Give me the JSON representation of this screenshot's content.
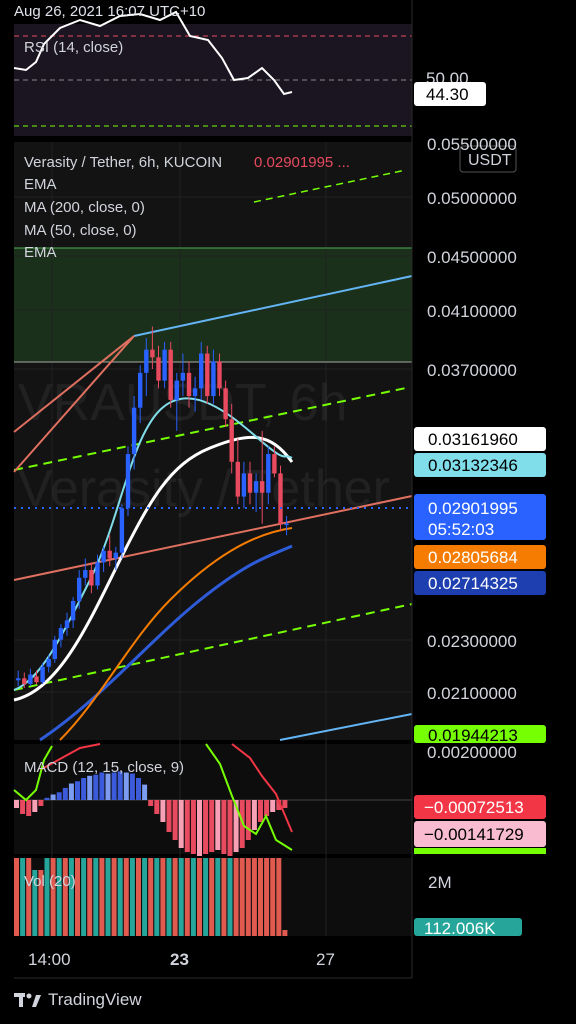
{
  "header": {
    "timestamp": "Aug 26, 2021 16:07 UTC+10"
  },
  "rsi": {
    "label": "RSI (14, close)",
    "value_tag": "44.30",
    "level_tick": "50.00"
  },
  "price_pane": {
    "title_symbol": "Verasity / Tether, 6h, KUCOIN",
    "title_price": "0.02901995 ...",
    "currency": "USDT",
    "watermark_line1": "VRAUSDT, 6h",
    "watermark_line2": "Verasity / Tether",
    "indicators": [
      "EMA",
      "MA (200, close, 0)",
      "MA (50, close, 0)",
      "EMA"
    ],
    "axis_ticks": [
      "0.05500000",
      "0.05000000",
      "0.04500000",
      "0.04100000",
      "0.03700000",
      "0.02300000",
      "0.02100000",
      "0.00200000"
    ],
    "tags": [
      {
        "text": "0.03161960",
        "bg": "#ffffff",
        "fg": "#000000"
      },
      {
        "text": "0.03132346",
        "bg": "#80deea",
        "fg": "#000000"
      },
      {
        "text": "0.02901995",
        "bg": "#2962ff",
        "fg": "#ffffff"
      },
      {
        "text": "05:52:03",
        "bg": "#2962ff",
        "fg": "#ffffff"
      },
      {
        "text": "0.02805684",
        "bg": "#f57c00",
        "fg": "#ffffff"
      },
      {
        "text": "0.02714325",
        "bg": "#1e3fb0",
        "fg": "#ffffff"
      },
      {
        "text": "0.01944213",
        "bg": "#76ff03",
        "fg": "#000000"
      }
    ]
  },
  "macd": {
    "label": "MACD (12, 15, close, 9)",
    "tags": [
      {
        "text": "−0.00072513",
        "bg": "#f23645",
        "fg": "#ffffff"
      },
      {
        "text": "−0.00141729",
        "bg": "#f8bbd0",
        "fg": "#000000"
      }
    ]
  },
  "volume": {
    "label": "Vol (20)",
    "axis_tick": "2M",
    "tag": "112.006K"
  },
  "time_axis": [
    "14:00",
    "23",
    "27"
  ],
  "footer": {
    "brand": "TradingView"
  },
  "chart_data": {
    "type": "candlestick",
    "symbol": "Verasity / Tether",
    "interval": "6h",
    "exchange": "KUCOIN",
    "last_price": 0.02901995,
    "countdown": "05:52:03",
    "candles": [
      {
        "o": 0.0209,
        "h": 0.0214,
        "l": 0.0206,
        "c": 0.021
      },
      {
        "o": 0.021,
        "h": 0.0213,
        "l": 0.0205,
        "c": 0.0207
      },
      {
        "o": 0.0207,
        "h": 0.0215,
        "l": 0.0206,
        "c": 0.0212
      },
      {
        "o": 0.0211,
        "h": 0.0214,
        "l": 0.0207,
        "c": 0.0208
      },
      {
        "o": 0.0208,
        "h": 0.0218,
        "l": 0.0207,
        "c": 0.0216
      },
      {
        "o": 0.0216,
        "h": 0.0222,
        "l": 0.0213,
        "c": 0.022
      },
      {
        "o": 0.022,
        "h": 0.0232,
        "l": 0.0218,
        "c": 0.023
      },
      {
        "o": 0.023,
        "h": 0.0238,
        "l": 0.0226,
        "c": 0.0236
      },
      {
        "o": 0.0236,
        "h": 0.0244,
        "l": 0.0232,
        "c": 0.024
      },
      {
        "o": 0.024,
        "h": 0.0252,
        "l": 0.0236,
        "c": 0.025
      },
      {
        "o": 0.025,
        "h": 0.0266,
        "l": 0.0246,
        "c": 0.0262
      },
      {
        "o": 0.0262,
        "h": 0.0272,
        "l": 0.0258,
        "c": 0.0266
      },
      {
        "o": 0.0266,
        "h": 0.027,
        "l": 0.0254,
        "c": 0.0258
      },
      {
        "o": 0.0258,
        "h": 0.0274,
        "l": 0.0256,
        "c": 0.027
      },
      {
        "o": 0.027,
        "h": 0.0278,
        "l": 0.0265,
        "c": 0.0276
      },
      {
        "o": 0.0276,
        "h": 0.0284,
        "l": 0.0268,
        "c": 0.0272
      },
      {
        "o": 0.0272,
        "h": 0.0278,
        "l": 0.0266,
        "c": 0.0275
      },
      {
        "o": 0.0275,
        "h": 0.03,
        "l": 0.0272,
        "c": 0.0298
      },
      {
        "o": 0.0298,
        "h": 0.033,
        "l": 0.0294,
        "c": 0.0326
      },
      {
        "o": 0.0326,
        "h": 0.0356,
        "l": 0.0318,
        "c": 0.035
      },
      {
        "o": 0.035,
        "h": 0.0372,
        "l": 0.0342,
        "c": 0.0368
      },
      {
        "o": 0.0368,
        "h": 0.0386,
        "l": 0.0356,
        "c": 0.038
      },
      {
        "o": 0.038,
        "h": 0.0392,
        "l": 0.037,
        "c": 0.0376
      },
      {
        "o": 0.0376,
        "h": 0.0382,
        "l": 0.036,
        "c": 0.0364
      },
      {
        "o": 0.0364,
        "h": 0.0384,
        "l": 0.036,
        "c": 0.038
      },
      {
        "o": 0.038,
        "h": 0.0384,
        "l": 0.035,
        "c": 0.0354
      },
      {
        "o": 0.0354,
        "h": 0.0368,
        "l": 0.0338,
        "c": 0.0364
      },
      {
        "o": 0.0364,
        "h": 0.0378,
        "l": 0.0356,
        "c": 0.0368
      },
      {
        "o": 0.0368,
        "h": 0.0374,
        "l": 0.035,
        "c": 0.0356
      },
      {
        "o": 0.0356,
        "h": 0.0366,
        "l": 0.0348,
        "c": 0.036
      },
      {
        "o": 0.036,
        "h": 0.0384,
        "l": 0.0354,
        "c": 0.0378
      },
      {
        "o": 0.0378,
        "h": 0.0382,
        "l": 0.0352,
        "c": 0.0356
      },
      {
        "o": 0.0356,
        "h": 0.038,
        "l": 0.0352,
        "c": 0.0374
      },
      {
        "o": 0.0374,
        "h": 0.0378,
        "l": 0.0356,
        "c": 0.036
      },
      {
        "o": 0.036,
        "h": 0.0364,
        "l": 0.034,
        "c": 0.0344
      },
      {
        "o": 0.0344,
        "h": 0.0352,
        "l": 0.0316,
        "c": 0.0322
      },
      {
        "o": 0.0322,
        "h": 0.0334,
        "l": 0.03,
        "c": 0.0304
      },
      {
        "o": 0.0304,
        "h": 0.0322,
        "l": 0.0298,
        "c": 0.0316
      },
      {
        "o": 0.0316,
        "h": 0.0322,
        "l": 0.03,
        "c": 0.0306
      },
      {
        "o": 0.0306,
        "h": 0.0316,
        "l": 0.0296,
        "c": 0.0312
      },
      {
        "o": 0.0312,
        "h": 0.0338,
        "l": 0.029,
        "c": 0.0306
      },
      {
        "o": 0.0306,
        "h": 0.033,
        "l": 0.03,
        "c": 0.0326
      },
      {
        "o": 0.0326,
        "h": 0.033,
        "l": 0.0314,
        "c": 0.0316
      },
      {
        "o": 0.0316,
        "h": 0.032,
        "l": 0.0286,
        "c": 0.029
      },
      {
        "o": 0.029,
        "h": 0.0294,
        "l": 0.0284,
        "c": 0.029
      }
    ],
    "colors": {
      "up": "#2962ff",
      "down": "#e84a5f"
    },
    "price_levels": {
      "ema_white": 0.0316196,
      "ema_cyan": 0.03132346,
      "ma_orange": 0.02805684,
      "ma_blue": 0.02714325,
      "green_level": 0.01944213,
      "range_top": 0.0456,
      "range_bottom": 0.0372
    },
    "rsi_value": 44.3,
    "volume_value": "112.006K"
  }
}
